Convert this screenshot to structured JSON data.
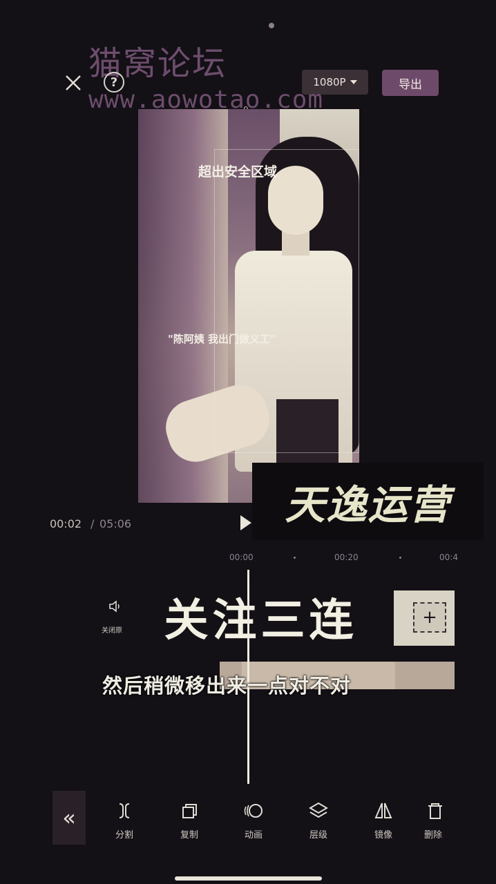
{
  "watermark": {
    "title": "猫窝论坛",
    "url": "www.aowotao.com"
  },
  "header": {
    "resolution": "1080P",
    "export_label": "导出",
    "help_label": "?"
  },
  "preview": {
    "ruler_zero": "0",
    "safe_area_text": "超出安全区域",
    "subtitle": "\"陈阿姨 我出门做义工\""
  },
  "playback": {
    "current_time": "00:02",
    "separator": "/",
    "total_time": "05:06"
  },
  "timeline": {
    "ticks": [
      "00:00",
      "00:20",
      "00:4"
    ],
    "mute_label": "关闭原",
    "add_label": "+"
  },
  "overlays": {
    "brand": "天逸运营",
    "cta": "关注三连",
    "caption": "然后稍微移出来一点对不对"
  },
  "toolbar": {
    "collapse_label": "«",
    "tools": [
      {
        "label": "分割",
        "icon": "split-icon"
      },
      {
        "label": "复制",
        "icon": "copy-icon"
      },
      {
        "label": "动画",
        "icon": "animation-icon"
      },
      {
        "label": "层级",
        "icon": "layers-icon"
      },
      {
        "label": "镜像",
        "icon": "mirror-icon"
      },
      {
        "label": "删除",
        "icon": "delete-icon"
      }
    ]
  },
  "colors": {
    "background": "#131016",
    "export": "#6e4a6a",
    "watermark": "#6d4d6c"
  }
}
